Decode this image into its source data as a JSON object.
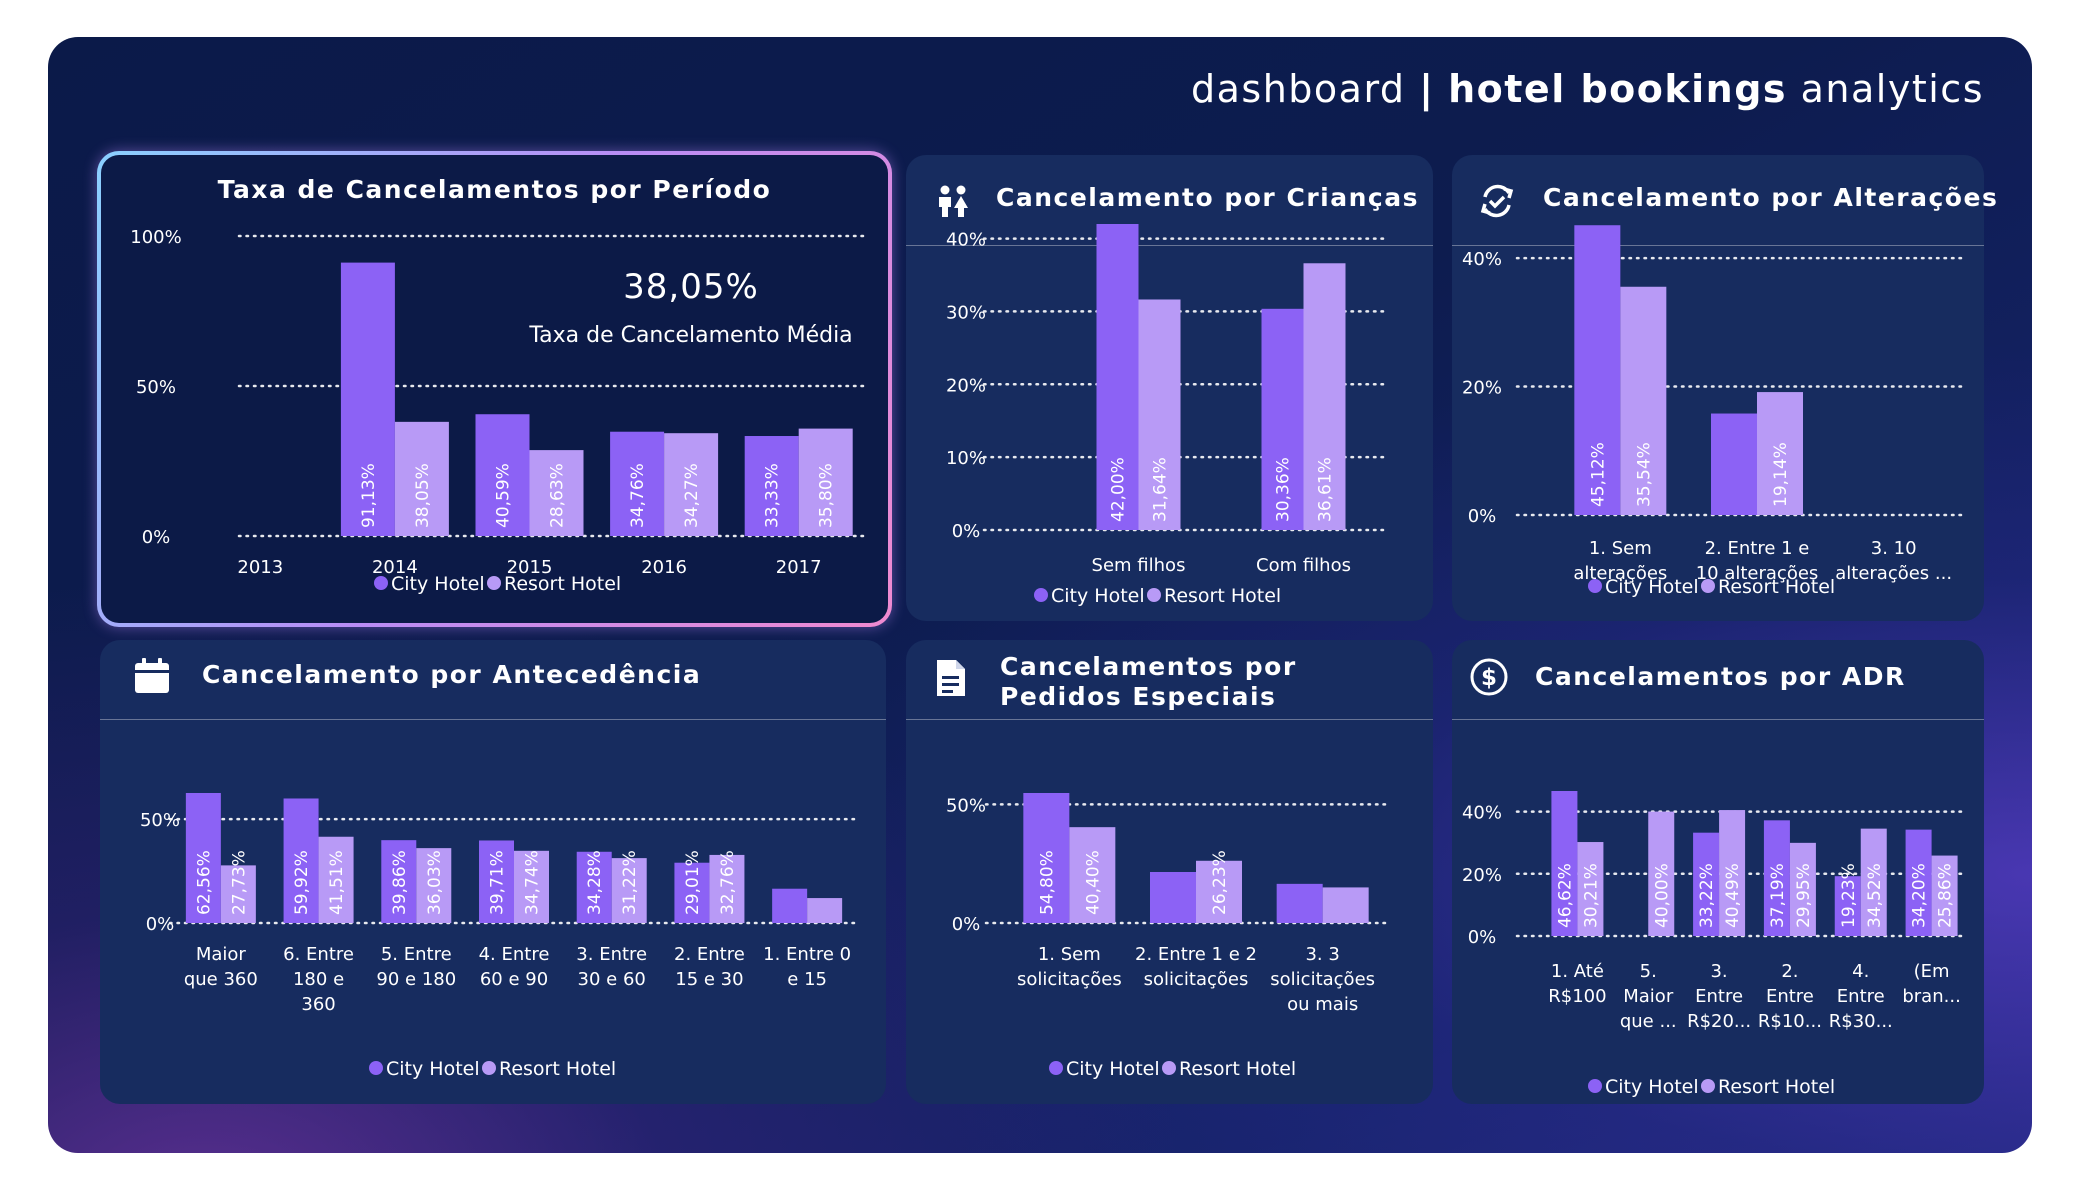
{
  "header": {
    "prefix": "dashboard",
    "separator": "|",
    "bold": "hotel bookings",
    "suffix": "analytics"
  },
  "legend": {
    "city": "City Hotel",
    "resort": "Resort Hotel"
  },
  "colors": {
    "city": "#8c62f5",
    "resort": "#b89af6",
    "grid": "#ffffff",
    "text": "#ffffff"
  },
  "cards": {
    "periodo": {
      "title": "Taxa de Cancelamentos por Período",
      "kpi_value": "38,05%",
      "kpi_label": "Taxa de Cancelamento Média"
    },
    "criancas": {
      "title": "Cancelamento por Crianças",
      "icon": "children-icon"
    },
    "alteracoes": {
      "title": "Cancelamento por Alterações",
      "icon": "refresh-check-icon"
    },
    "antecedencia": {
      "title": "Cancelamento por Antecedência",
      "icon": "calendar-icon"
    },
    "pedidos": {
      "title": "Cancelamentos por Pedidos Especiais",
      "icon": "document-icon"
    },
    "adr": {
      "title": "Cancelamentos por ADR",
      "icon": "dollar-circle-icon"
    }
  },
  "chart_data": [
    {
      "id": "periodo",
      "type": "bar",
      "title": "Taxa de Cancelamentos por Período",
      "categories": [
        "2013",
        "2014",
        "2015",
        "2016",
        "2017"
      ],
      "series": [
        {
          "name": "City Hotel",
          "values": [
            null,
            91.13,
            40.59,
            34.76,
            33.33
          ],
          "labels": [
            "",
            "91,13%",
            "40,59%",
            "34,76%",
            "33,33%"
          ]
        },
        {
          "name": "Resort Hotel",
          "values": [
            null,
            38.05,
            28.63,
            34.27,
            35.8
          ],
          "labels": [
            "",
            "38,05%",
            "28,63%",
            "34,27%",
            "35,80%"
          ]
        }
      ],
      "ylim": [
        0,
        100
      ],
      "yticks": [
        0,
        50,
        100
      ],
      "ytick_labels": [
        "0%",
        "50%",
        "100%"
      ],
      "grid": true,
      "legend": "bottom"
    },
    {
      "id": "criancas",
      "type": "bar",
      "title": "Cancelamento por Crianças",
      "categories": [
        "Sem filhos",
        "Com filhos"
      ],
      "series": [
        {
          "name": "City Hotel",
          "values": [
            42.0,
            30.36
          ],
          "labels": [
            "42,00%",
            "30,36%"
          ]
        },
        {
          "name": "Resort Hotel",
          "values": [
            31.64,
            36.61
          ],
          "labels": [
            "31,64%",
            "36,61%"
          ]
        }
      ],
      "ylim": [
        0,
        42
      ],
      "yticks": [
        0,
        10,
        20,
        30,
        40
      ],
      "ytick_labels": [
        "0%",
        "10%",
        "20%",
        "30%",
        "40%"
      ],
      "grid": true,
      "legend": "bottom"
    },
    {
      "id": "alteracoes",
      "type": "bar",
      "title": "Cancelamento por Alterações",
      "categories": [
        [
          "1. Sem",
          "alterações"
        ],
        [
          "2. Entre 1 e",
          "10 alterações"
        ],
        [
          "3. 10",
          "alterações ..."
        ]
      ],
      "series": [
        {
          "name": "City Hotel",
          "values": [
            45.12,
            15.8,
            null
          ],
          "labels": [
            "45,12%",
            "",
            ""
          ]
        },
        {
          "name": "Resort Hotel",
          "values": [
            35.54,
            19.14,
            null
          ],
          "labels": [
            "35,54%",
            "19,14%",
            ""
          ]
        }
      ],
      "ylim": [
        0,
        45
      ],
      "yticks": [
        0,
        20,
        40
      ],
      "ytick_labels": [
        "0%",
        "20%",
        "40%"
      ],
      "grid": true,
      "legend": "bottom"
    },
    {
      "id": "antecedencia",
      "type": "bar",
      "title": "Cancelamento por Antecedência",
      "categories": [
        [
          "Maior",
          "que 360"
        ],
        [
          "6. Entre",
          "180 e",
          "360"
        ],
        [
          "5. Entre",
          "90 e 180"
        ],
        [
          "4. Entre",
          "60 e 90"
        ],
        [
          "3. Entre",
          "30 e 60"
        ],
        [
          "2. Entre",
          "15 e 30"
        ],
        [
          "1. Entre 0",
          "e 15"
        ]
      ],
      "series": [
        {
          "name": "City Hotel",
          "values": [
            62.56,
            59.92,
            39.86,
            39.71,
            34.28,
            29.01,
            16.5
          ],
          "labels": [
            "62,56%",
            "59,92%",
            "39,86%",
            "39,71%",
            "34,28%",
            "29,01%",
            ""
          ]
        },
        {
          "name": "Resort Hotel",
          "values": [
            27.73,
            41.51,
            36.03,
            34.74,
            31.22,
            32.76,
            12.0
          ],
          "labels": [
            "27,73%",
            "41,51%",
            "36,03%",
            "34,74%",
            "31,22%",
            "32,76%",
            ""
          ]
        }
      ],
      "ylim": [
        0,
        62.56
      ],
      "yticks": [
        0,
        50
      ],
      "ytick_labels": [
        "0%",
        "50%"
      ],
      "grid": true,
      "legend": "bottom"
    },
    {
      "id": "pedidos",
      "type": "bar",
      "title": "Cancelamentos por Pedidos Especiais",
      "categories": [
        [
          "1. Sem",
          "solicitações"
        ],
        [
          "2. Entre 1 e 2",
          "solicitações"
        ],
        [
          "3. 3",
          "solicitações",
          "ou mais"
        ]
      ],
      "series": [
        {
          "name": "City Hotel",
          "values": [
            54.8,
            21.5,
            16.5
          ],
          "labels": [
            "54,80%",
            "",
            ""
          ]
        },
        {
          "name": "Resort Hotel",
          "values": [
            40.4,
            26.23,
            15.0
          ],
          "labels": [
            "40,40%",
            "26,23%",
            ""
          ]
        }
      ],
      "ylim": [
        0,
        54.8
      ],
      "yticks": [
        0,
        50
      ],
      "ytick_labels": [
        "0%",
        "50%"
      ],
      "grid": true,
      "legend": "bottom"
    },
    {
      "id": "adr",
      "type": "bar",
      "title": "Cancelamentos por ADR",
      "categories": [
        [
          "1. Até",
          "R$100"
        ],
        [
          "5.",
          "Maior",
          "que ..."
        ],
        [
          "3.",
          "Entre",
          "R$20..."
        ],
        [
          "2.",
          "Entre",
          "R$10..."
        ],
        [
          "4.",
          "Entre",
          "R$30..."
        ],
        [
          "(Em",
          "bran..."
        ]
      ],
      "series": [
        {
          "name": "City Hotel",
          "values": [
            46.62,
            null,
            33.22,
            37.19,
            19.23,
            34.2
          ],
          "labels": [
            "46,62%",
            "",
            "33,22%",
            "37,19%",
            "19,23%",
            "34,20%"
          ]
        },
        {
          "name": "Resort Hotel",
          "values": [
            30.21,
            40.0,
            40.49,
            29.95,
            34.52,
            25.86
          ],
          "labels": [
            "30,21%",
            "40,00%",
            "40,49%",
            "29,95%",
            "34,52%",
            "25,86%"
          ]
        }
      ],
      "ylim": [
        0,
        46.62
      ],
      "yticks": [
        0,
        20,
        40
      ],
      "ytick_labels": [
        "0%",
        "20%",
        "40%"
      ],
      "grid": true,
      "legend": "bottom"
    }
  ]
}
